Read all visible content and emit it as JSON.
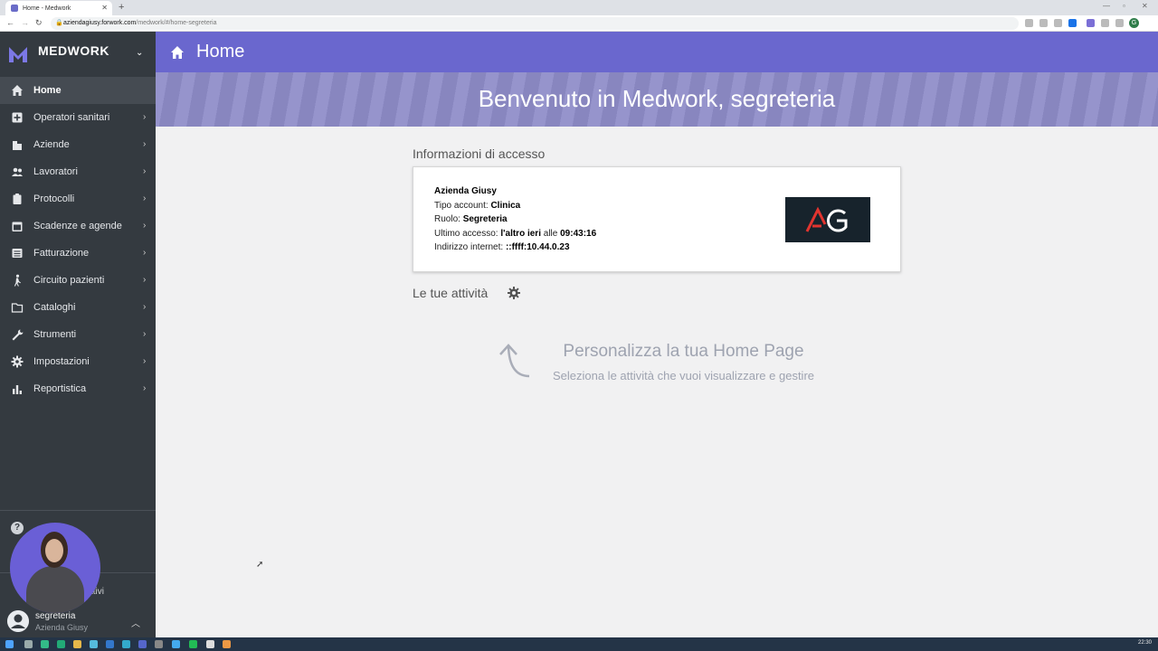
{
  "browser": {
    "tab_title": "Home - Medwork",
    "new_tab": "+",
    "url_host": "aziendagiusy.forwork.com",
    "url_path": "/medwork/#/home-segreteria",
    "profile_initial": "G"
  },
  "sidebar": {
    "brand": "MEDWORK",
    "items": [
      {
        "label": "Home",
        "icon": "home-icon",
        "active": true
      },
      {
        "label": "Operatori sanitari",
        "icon": "plus-square-icon"
      },
      {
        "label": "Aziende",
        "icon": "building-icon"
      },
      {
        "label": "Lavoratori",
        "icon": "users-icon"
      },
      {
        "label": "Protocolli",
        "icon": "clipboard-icon"
      },
      {
        "label": "Scadenze e agende",
        "icon": "calendar-icon"
      },
      {
        "label": "Fatturazione",
        "icon": "list-icon"
      },
      {
        "label": "Circuito pazienti",
        "icon": "walking-icon"
      },
      {
        "label": "Cataloghi",
        "icon": "folder-icon"
      },
      {
        "label": "Strumenti",
        "icon": "wrench-icon"
      },
      {
        "label": "Impostazioni",
        "icon": "gear-icon"
      },
      {
        "label": "Reportistica",
        "icon": "bar-chart-icon"
      }
    ],
    "help_icon": "?",
    "attivi_text": "ttivi",
    "user": {
      "name": "segreteria",
      "org": "Azienda Giusy"
    }
  },
  "header": {
    "title": "Home"
  },
  "banner": {
    "welcome": "Benvenuto in Medwork, segreteria"
  },
  "access": {
    "section_title": "Informazioni di accesso",
    "company": "Azienda Giusy",
    "account_label": "Tipo account:",
    "account_value": "Clinica",
    "role_label": "Ruolo:",
    "role_value": "Segreteria",
    "last_label": "Ultimo accesso:",
    "last_day": "l'altro ieri",
    "last_at": "alle",
    "last_time": "09:43:16",
    "ip_label": "Indirizzo internet:",
    "ip_value": "::ffff:10.44.0.23",
    "logo_text": "AG"
  },
  "activities": {
    "section_title": "Le tue attività",
    "title": "Personalizza la tua Home Page",
    "subtitle": "Seleziona le attività che vuoi visualizzare e gestire"
  },
  "taskbar": {
    "clock": "22:30"
  },
  "colors": {
    "header": "#6a67ce",
    "sidebar": "#343a40",
    "banner": "#8f8dc9"
  }
}
